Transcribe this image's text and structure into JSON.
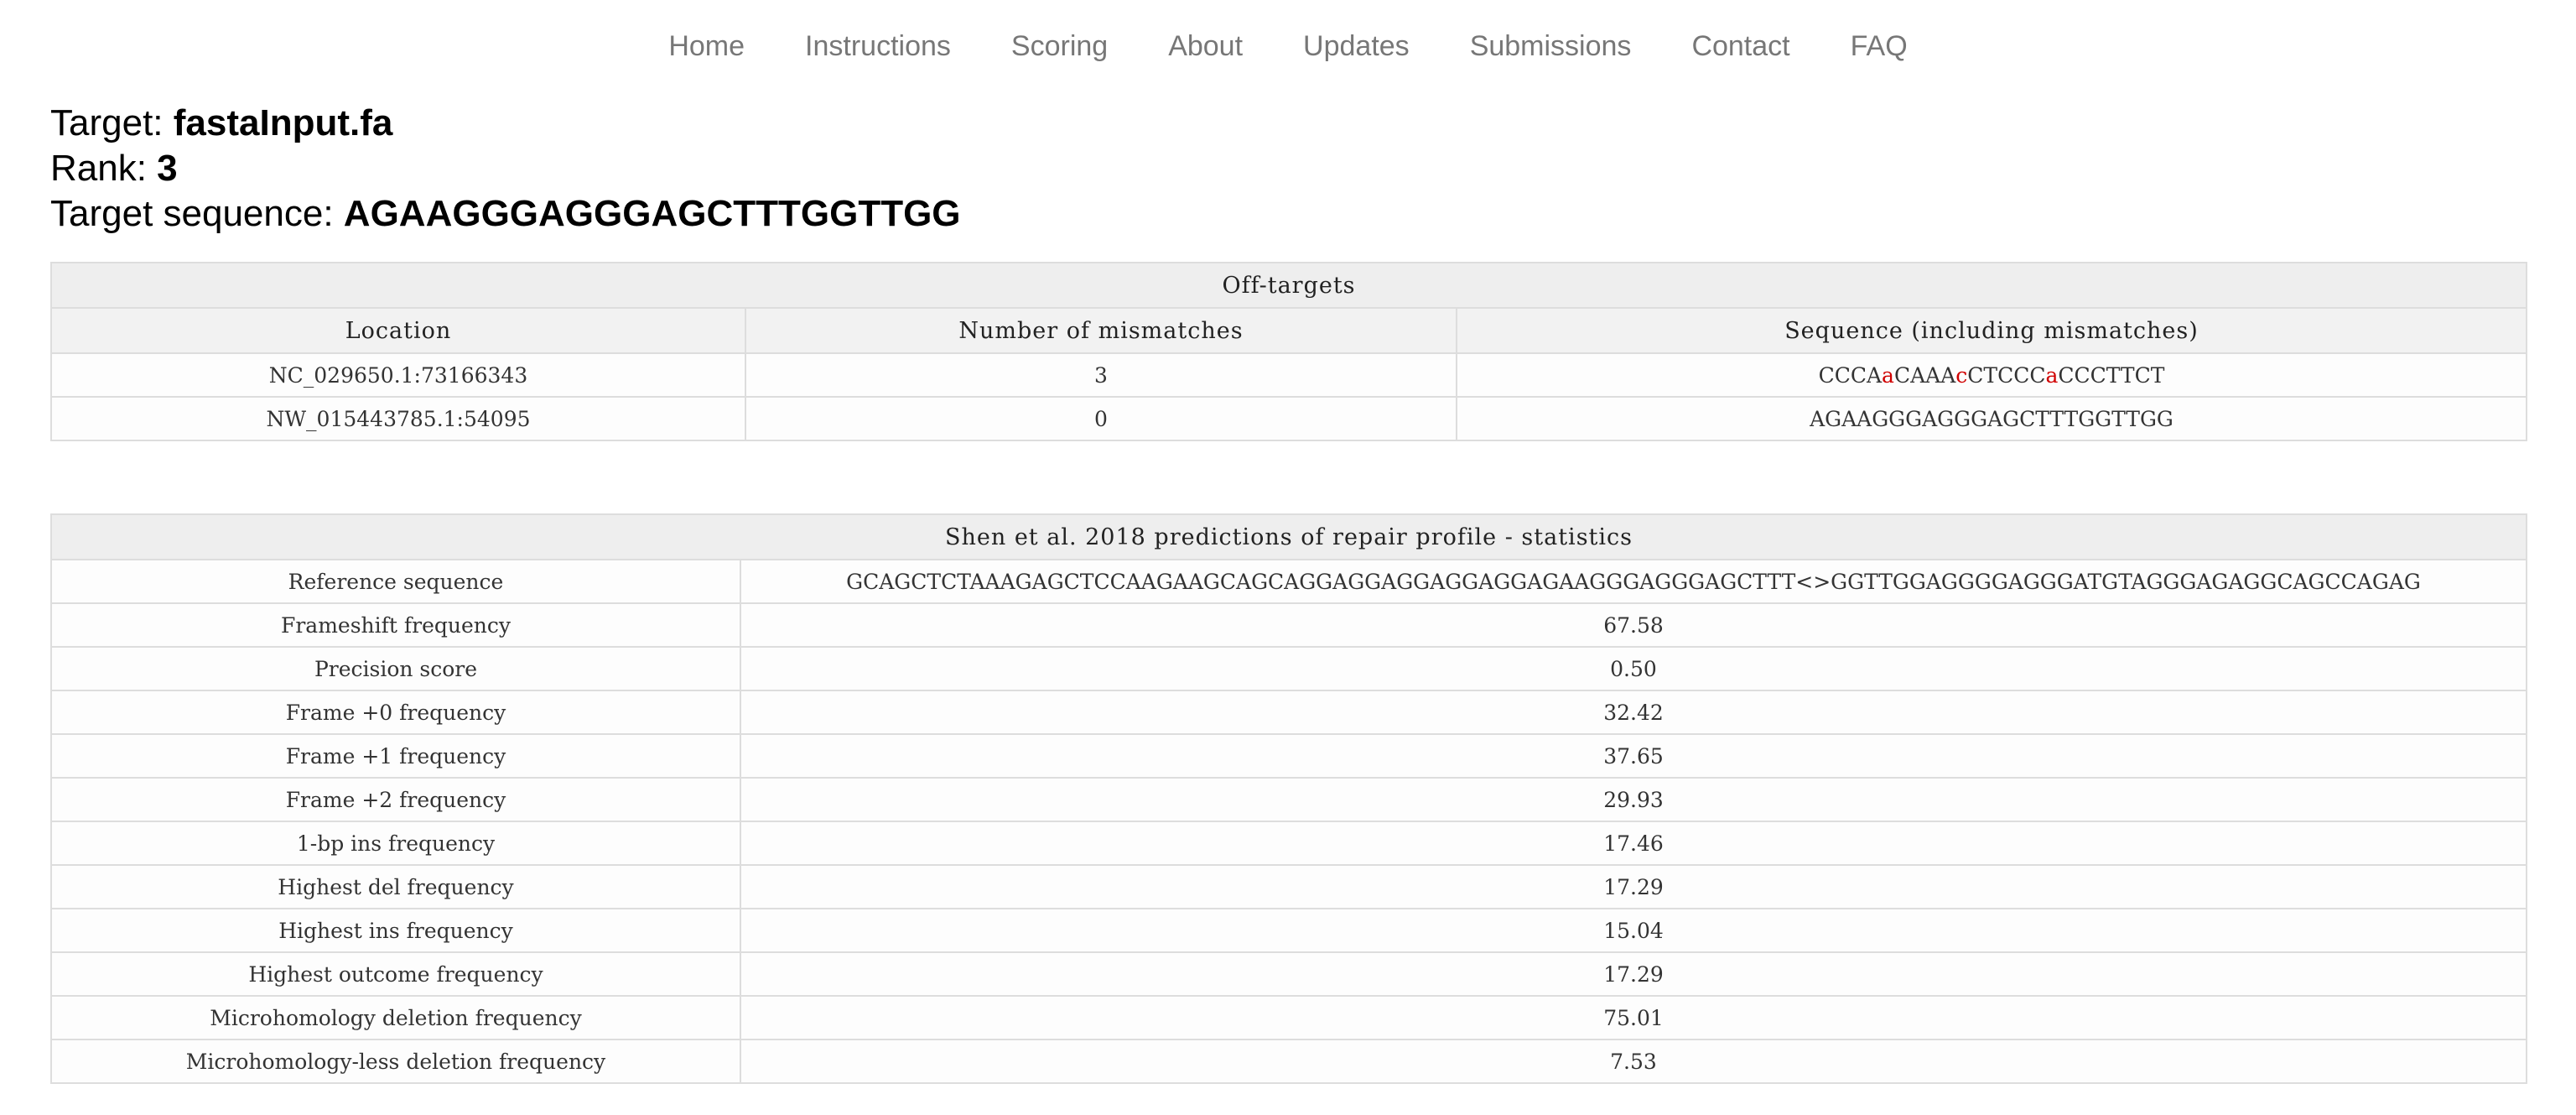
{
  "nav": {
    "items": [
      {
        "label": "Home"
      },
      {
        "label": "Instructions"
      },
      {
        "label": "Scoring"
      },
      {
        "label": "About"
      },
      {
        "label": "Updates"
      },
      {
        "label": "Submissions"
      },
      {
        "label": "Contact"
      },
      {
        "label": "FAQ"
      }
    ]
  },
  "target": {
    "target_label": "Target: ",
    "target_value": "fastaInput.fa",
    "rank_label": "Rank: ",
    "rank_value": "3",
    "sequence_label": "Target sequence: ",
    "sequence_value": "AGAAGGGAGGGAGCTTTGGTTGG"
  },
  "offtargets": {
    "caption": "Off-targets",
    "headers": [
      "Location",
      "Number of mismatches",
      "Sequence (including mismatches)"
    ],
    "rows": [
      {
        "location": "NC_029650.1:73166343",
        "mismatches": "3",
        "sequence_parts": [
          {
            "text": "CCCA",
            "mismatch": false
          },
          {
            "text": "a",
            "mismatch": true
          },
          {
            "text": "CAAA",
            "mismatch": false
          },
          {
            "text": "c",
            "mismatch": true
          },
          {
            "text": "CTCCC",
            "mismatch": false
          },
          {
            "text": "a",
            "mismatch": true
          },
          {
            "text": "CCCTTCT",
            "mismatch": false
          }
        ]
      },
      {
        "location": "NW_015443785.1:54095",
        "mismatches": "0",
        "sequence_parts": [
          {
            "text": "AGAAGGGAGGGAGCTTTGGTTGG",
            "mismatch": false
          }
        ]
      }
    ],
    "mismatch_color": "#d00000"
  },
  "repair": {
    "caption": "Shen et al. 2018 predictions of repair profile - statistics",
    "rows": [
      {
        "label": "Reference sequence",
        "value": "GCAGCTCTAAAGAGCTCCAAGAAGCAGCAGGAGGAGGAGGAGGAGAAGGGAGGGAGCTTT<>GGTTGGAGGGGAGGGATGTAGGGAGAGGCAGCCAGAG"
      },
      {
        "label": "Frameshift frequency",
        "value": "67.58"
      },
      {
        "label": "Precision score",
        "value": "0.50"
      },
      {
        "label": "Frame +0 frequency",
        "value": "32.42"
      },
      {
        "label": "Frame +1 frequency",
        "value": "37.65"
      },
      {
        "label": "Frame +2 frequency",
        "value": "29.93"
      },
      {
        "label": "1-bp ins frequency",
        "value": "17.46"
      },
      {
        "label": "Highest del frequency",
        "value": "17.29"
      },
      {
        "label": "Highest ins frequency",
        "value": "15.04"
      },
      {
        "label": "Highest outcome frequency",
        "value": "17.29"
      },
      {
        "label": "Microhomology deletion frequency",
        "value": "75.01"
      },
      {
        "label": "Microhomology-less deletion frequency",
        "value": "7.53"
      }
    ]
  }
}
